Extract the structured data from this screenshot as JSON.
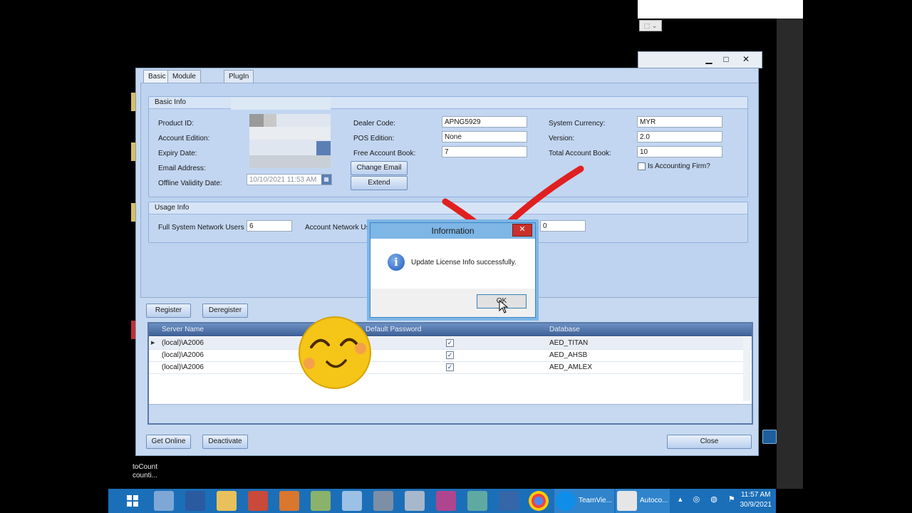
{
  "window": {
    "tabs": [
      "Basic",
      "Module Details",
      "PlugIn"
    ],
    "controls": {
      "minimize": "▁",
      "maximize": "□",
      "close": "✕"
    }
  },
  "basic_info": {
    "title": "Basic Info",
    "product_id_label": "Product ID:",
    "account_edition_label": "Account Edition:",
    "expiry_date_label": "Expiry Date:",
    "email_label": "Email Address:",
    "offline_validity_label": "Offline Validity Date:",
    "offline_validity_value": "10/10/2021 11:53 AM",
    "dealer_code_label": "Dealer Code:",
    "dealer_code_value": "APNG5929",
    "pos_edition_label": "POS Edition:",
    "pos_edition_value": "None",
    "free_account_book_label": "Free Account Book:",
    "free_account_book_value": "7",
    "system_currency_label": "System Currency:",
    "system_currency_value": "MYR",
    "version_label": "Version:",
    "version_value": "2.0",
    "total_account_book_label": "Total Account Book:",
    "total_account_book_value": "10",
    "accounting_firm_label": "Is Accounting Firm?",
    "change_email_button": "Change Email",
    "extend_button": "Extend"
  },
  "usage_info": {
    "title": "Usage Info",
    "full_system_label": "Full System Network Users",
    "full_system_value": "6",
    "account_network_label": "Account Network Use",
    "other_value": "0"
  },
  "actions": {
    "register": "Register",
    "deregister": "Deregister",
    "get_online": "Get Online",
    "deactivate": "Deactivate",
    "close": "Close"
  },
  "grid": {
    "headers": [
      "Server Name",
      "Default Password",
      "Database"
    ],
    "rows": [
      {
        "server": "(local)\\A2006",
        "default_password": true,
        "database": "AED_TITAN"
      },
      {
        "server": "(local)\\A2006",
        "default_password": true,
        "database": "AED_AHSB"
      },
      {
        "server": "(local)\\A2006",
        "default_password": true,
        "database": "AED_AMLEX"
      }
    ]
  },
  "dialog": {
    "title": "Information",
    "message": "Update License Info successfully.",
    "ok": "OK",
    "icon": "info-icon"
  },
  "desktop": {
    "side_label_line1": "toCount",
    "side_label_line2": "counti..."
  },
  "taskbar": {
    "apps": [
      "start-icon",
      "server-manager-icon",
      "powershell-icon",
      "file-explorer-icon",
      "toolbox-icon",
      "device-icon",
      "network-icon",
      "folder-icon",
      "settings-icon",
      "camera-icon",
      "paint-icon",
      "notes-icon",
      "remote-icon",
      "chrome-icon"
    ],
    "teamviewer_label": "TeamVie...",
    "autocount_label": "Autoco...",
    "clock_time": "11:57 AM",
    "clock_date": "30/9/2021"
  },
  "colors": {
    "accent": "#1b6fb8",
    "window_bg": "#c6d9f1",
    "grid_header": "#4d6fa6",
    "check_mark": "#e02020",
    "emoji": "#f5c518"
  }
}
